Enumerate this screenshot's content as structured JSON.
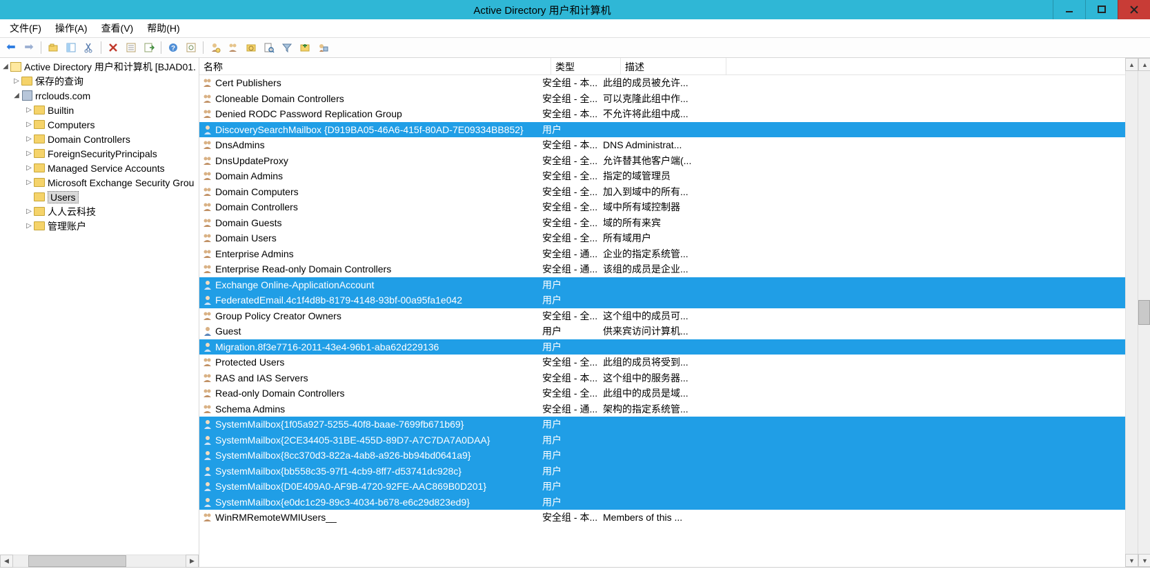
{
  "window": {
    "title": "Active Directory 用户和计算机"
  },
  "menu": {
    "file": "文件(F)",
    "action": "操作(A)",
    "view": "查看(V)",
    "help": "帮助(H)"
  },
  "tree": {
    "root": "Active Directory 用户和计算机 [BJAD01.",
    "saved_queries": "保存的查询",
    "domain": "rrclouds.com",
    "builtin": "Builtin",
    "computers": "Computers",
    "dc": "Domain Controllers",
    "fsp": "ForeignSecurityPrincipals",
    "msa": "Managed Service Accounts",
    "mesg": "Microsoft Exchange Security Grou",
    "users": "Users",
    "renren": "人人云科技",
    "guanli": "管理账户"
  },
  "columns": {
    "name": "名称",
    "type": "类型",
    "desc": "描述"
  },
  "rows": [
    {
      "icon": "group",
      "name": "Cert Publishers",
      "type": "安全组 - 本...",
      "desc": "此组的成员被允许...",
      "sel": false
    },
    {
      "icon": "group",
      "name": "Cloneable Domain Controllers",
      "type": "安全组 - 全...",
      "desc": "可以克隆此组中作...",
      "sel": false
    },
    {
      "icon": "group",
      "name": "Denied RODC Password Replication Group",
      "type": "安全组 - 本...",
      "desc": "不允许将此组中成...",
      "sel": false
    },
    {
      "icon": "user",
      "name": "DiscoverySearchMailbox {D919BA05-46A6-415f-80AD-7E09334BB852}",
      "type": "用户",
      "desc": "",
      "sel": true
    },
    {
      "icon": "group",
      "name": "DnsAdmins",
      "type": "安全组 - 本...",
      "desc": "DNS Administrat...",
      "sel": false
    },
    {
      "icon": "group",
      "name": "DnsUpdateProxy",
      "type": "安全组 - 全...",
      "desc": "允许替其他客户端(...",
      "sel": false
    },
    {
      "icon": "group",
      "name": "Domain Admins",
      "type": "安全组 - 全...",
      "desc": "指定的域管理员",
      "sel": false
    },
    {
      "icon": "group",
      "name": "Domain Computers",
      "type": "安全组 - 全...",
      "desc": "加入到域中的所有...",
      "sel": false
    },
    {
      "icon": "group",
      "name": "Domain Controllers",
      "type": "安全组 - 全...",
      "desc": "域中所有域控制器",
      "sel": false
    },
    {
      "icon": "group",
      "name": "Domain Guests",
      "type": "安全组 - 全...",
      "desc": "域的所有来宾",
      "sel": false
    },
    {
      "icon": "group",
      "name": "Domain Users",
      "type": "安全组 - 全...",
      "desc": "所有域用户",
      "sel": false
    },
    {
      "icon": "group",
      "name": "Enterprise Admins",
      "type": "安全组 - 通...",
      "desc": "企业的指定系统管...",
      "sel": false
    },
    {
      "icon": "group",
      "name": "Enterprise Read-only Domain Controllers",
      "type": "安全组 - 通...",
      "desc": "该组的成员是企业...",
      "sel": false
    },
    {
      "icon": "user",
      "name": "Exchange Online-ApplicationAccount",
      "type": "用户",
      "desc": "",
      "sel": true
    },
    {
      "icon": "user",
      "name": "FederatedEmail.4c1f4d8b-8179-4148-93bf-00a95fa1e042",
      "type": "用户",
      "desc": "",
      "sel": true
    },
    {
      "icon": "group",
      "name": "Group Policy Creator Owners",
      "type": "安全组 - 全...",
      "desc": "这个组中的成员可...",
      "sel": false
    },
    {
      "icon": "user",
      "name": "Guest",
      "type": "用户",
      "desc": "供来宾访问计算机...",
      "sel": false
    },
    {
      "icon": "user",
      "name": "Migration.8f3e7716-2011-43e4-96b1-aba62d229136",
      "type": "用户",
      "desc": "",
      "sel": true
    },
    {
      "icon": "group",
      "name": "Protected Users",
      "type": "安全组 - 全...",
      "desc": "此组的成员将受到...",
      "sel": false
    },
    {
      "icon": "group",
      "name": "RAS and IAS Servers",
      "type": "安全组 - 本...",
      "desc": "这个组中的服务器...",
      "sel": false
    },
    {
      "icon": "group",
      "name": "Read-only Domain Controllers",
      "type": "安全组 - 全...",
      "desc": "此组中的成员是域...",
      "sel": false
    },
    {
      "icon": "group",
      "name": "Schema Admins",
      "type": "安全组 - 通...",
      "desc": "架构的指定系统管...",
      "sel": false
    },
    {
      "icon": "user",
      "name": "SystemMailbox{1f05a927-5255-40f8-baae-7699fb671b69}",
      "type": "用户",
      "desc": "",
      "sel": true
    },
    {
      "icon": "user",
      "name": "SystemMailbox{2CE34405-31BE-455D-89D7-A7C7DA7A0DAA}",
      "type": "用户",
      "desc": "",
      "sel": true
    },
    {
      "icon": "user",
      "name": "SystemMailbox{8cc370d3-822a-4ab8-a926-bb94bd0641a9}",
      "type": "用户",
      "desc": "",
      "sel": true
    },
    {
      "icon": "user",
      "name": "SystemMailbox{bb558c35-97f1-4cb9-8ff7-d53741dc928c}",
      "type": "用户",
      "desc": "",
      "sel": true
    },
    {
      "icon": "user",
      "name": "SystemMailbox{D0E409A0-AF9B-4720-92FE-AAC869B0D201}",
      "type": "用户",
      "desc": "",
      "sel": true
    },
    {
      "icon": "user",
      "name": "SystemMailbox{e0dc1c29-89c3-4034-b678-e6c29d823ed9}",
      "type": "用户",
      "desc": "",
      "sel": true
    },
    {
      "icon": "group",
      "name": "WinRMRemoteWMIUsers__",
      "type": "安全组 - 本...",
      "desc": "Members of this ...",
      "sel": false
    }
  ]
}
